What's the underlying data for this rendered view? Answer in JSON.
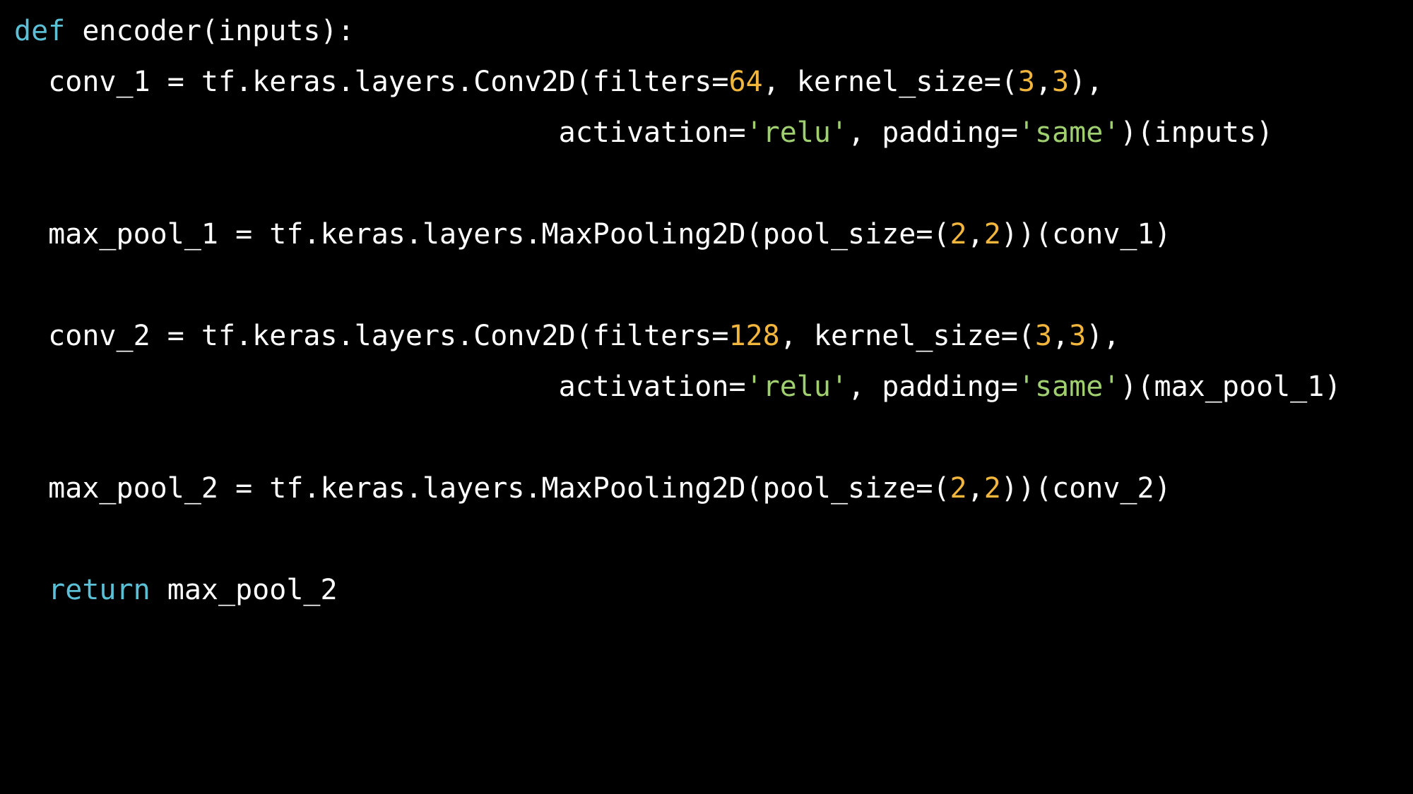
{
  "colors": {
    "background": "#000000",
    "default": "#ffffff",
    "keyword": "#5bc0d6",
    "number": "#f2b63c",
    "string": "#9fcf6e"
  },
  "code": {
    "language": "python",
    "lines": [
      {
        "tokens": [
          {
            "t": "def",
            "k": "kw"
          },
          {
            "t": " encoder(inputs):",
            "k": "plain"
          }
        ]
      },
      {
        "tokens": [
          {
            "t": "  conv_1 = tf.keras.layers.Conv2D(filters=",
            "k": "plain"
          },
          {
            "t": "64",
            "k": "num"
          },
          {
            "t": ", kernel_size=(",
            "k": "plain"
          },
          {
            "t": "3",
            "k": "num"
          },
          {
            "t": ",",
            "k": "plain"
          },
          {
            "t": "3",
            "k": "num"
          },
          {
            "t": "),",
            "k": "plain"
          }
        ]
      },
      {
        "tokens": [
          {
            "t": "                                activation=",
            "k": "plain"
          },
          {
            "t": "'relu'",
            "k": "str"
          },
          {
            "t": ", padding=",
            "k": "plain"
          },
          {
            "t": "'same'",
            "k": "str"
          },
          {
            "t": ")(inputs)",
            "k": "plain"
          }
        ]
      },
      {
        "tokens": []
      },
      {
        "tokens": [
          {
            "t": "  max_pool_1 = tf.keras.layers.MaxPooling2D(pool_size=(",
            "k": "plain"
          },
          {
            "t": "2",
            "k": "num"
          },
          {
            "t": ",",
            "k": "plain"
          },
          {
            "t": "2",
            "k": "num"
          },
          {
            "t": "))(conv_1)",
            "k": "plain"
          }
        ]
      },
      {
        "tokens": []
      },
      {
        "tokens": [
          {
            "t": "  conv_2 = tf.keras.layers.Conv2D(filters=",
            "k": "plain"
          },
          {
            "t": "128",
            "k": "num"
          },
          {
            "t": ", kernel_size=(",
            "k": "plain"
          },
          {
            "t": "3",
            "k": "num"
          },
          {
            "t": ",",
            "k": "plain"
          },
          {
            "t": "3",
            "k": "num"
          },
          {
            "t": "),",
            "k": "plain"
          }
        ]
      },
      {
        "tokens": [
          {
            "t": "                                activation=",
            "k": "plain"
          },
          {
            "t": "'relu'",
            "k": "str"
          },
          {
            "t": ", padding=",
            "k": "plain"
          },
          {
            "t": "'same'",
            "k": "str"
          },
          {
            "t": ")(max_pool_1)",
            "k": "plain"
          }
        ]
      },
      {
        "tokens": []
      },
      {
        "tokens": [
          {
            "t": "  max_pool_2 = tf.keras.layers.MaxPooling2D(pool_size=(",
            "k": "plain"
          },
          {
            "t": "2",
            "k": "num"
          },
          {
            "t": ",",
            "k": "plain"
          },
          {
            "t": "2",
            "k": "num"
          },
          {
            "t": "))(conv_2)",
            "k": "plain"
          }
        ]
      },
      {
        "tokens": []
      },
      {
        "tokens": [
          {
            "t": "  return",
            "k": "kw"
          },
          {
            "t": " max_pool_2",
            "k": "plain"
          }
        ]
      }
    ]
  }
}
